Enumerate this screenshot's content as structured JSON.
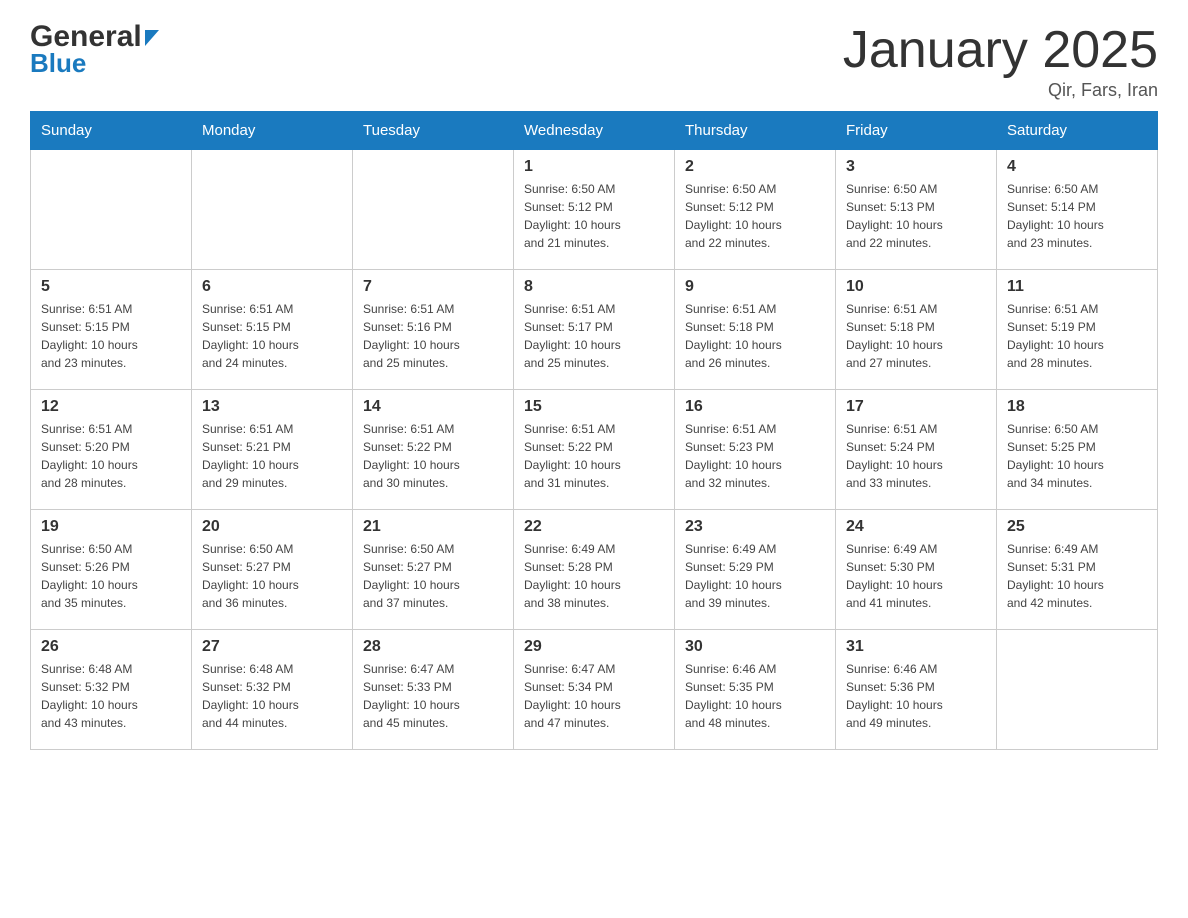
{
  "header": {
    "logo_text1": "General",
    "logo_text2": "Blue",
    "month_title": "January 2025",
    "subtitle": "Qir, Fars, Iran"
  },
  "days_of_week": [
    "Sunday",
    "Monday",
    "Tuesday",
    "Wednesday",
    "Thursday",
    "Friday",
    "Saturday"
  ],
  "weeks": [
    [
      {
        "day": "",
        "info": ""
      },
      {
        "day": "",
        "info": ""
      },
      {
        "day": "",
        "info": ""
      },
      {
        "day": "1",
        "info": "Sunrise: 6:50 AM\nSunset: 5:12 PM\nDaylight: 10 hours\nand 21 minutes."
      },
      {
        "day": "2",
        "info": "Sunrise: 6:50 AM\nSunset: 5:12 PM\nDaylight: 10 hours\nand 22 minutes."
      },
      {
        "day": "3",
        "info": "Sunrise: 6:50 AM\nSunset: 5:13 PM\nDaylight: 10 hours\nand 22 minutes."
      },
      {
        "day": "4",
        "info": "Sunrise: 6:50 AM\nSunset: 5:14 PM\nDaylight: 10 hours\nand 23 minutes."
      }
    ],
    [
      {
        "day": "5",
        "info": "Sunrise: 6:51 AM\nSunset: 5:15 PM\nDaylight: 10 hours\nand 23 minutes."
      },
      {
        "day": "6",
        "info": "Sunrise: 6:51 AM\nSunset: 5:15 PM\nDaylight: 10 hours\nand 24 minutes."
      },
      {
        "day": "7",
        "info": "Sunrise: 6:51 AM\nSunset: 5:16 PM\nDaylight: 10 hours\nand 25 minutes."
      },
      {
        "day": "8",
        "info": "Sunrise: 6:51 AM\nSunset: 5:17 PM\nDaylight: 10 hours\nand 25 minutes."
      },
      {
        "day": "9",
        "info": "Sunrise: 6:51 AM\nSunset: 5:18 PM\nDaylight: 10 hours\nand 26 minutes."
      },
      {
        "day": "10",
        "info": "Sunrise: 6:51 AM\nSunset: 5:18 PM\nDaylight: 10 hours\nand 27 minutes."
      },
      {
        "day": "11",
        "info": "Sunrise: 6:51 AM\nSunset: 5:19 PM\nDaylight: 10 hours\nand 28 minutes."
      }
    ],
    [
      {
        "day": "12",
        "info": "Sunrise: 6:51 AM\nSunset: 5:20 PM\nDaylight: 10 hours\nand 28 minutes."
      },
      {
        "day": "13",
        "info": "Sunrise: 6:51 AM\nSunset: 5:21 PM\nDaylight: 10 hours\nand 29 minutes."
      },
      {
        "day": "14",
        "info": "Sunrise: 6:51 AM\nSunset: 5:22 PM\nDaylight: 10 hours\nand 30 minutes."
      },
      {
        "day": "15",
        "info": "Sunrise: 6:51 AM\nSunset: 5:22 PM\nDaylight: 10 hours\nand 31 minutes."
      },
      {
        "day": "16",
        "info": "Sunrise: 6:51 AM\nSunset: 5:23 PM\nDaylight: 10 hours\nand 32 minutes."
      },
      {
        "day": "17",
        "info": "Sunrise: 6:51 AM\nSunset: 5:24 PM\nDaylight: 10 hours\nand 33 minutes."
      },
      {
        "day": "18",
        "info": "Sunrise: 6:50 AM\nSunset: 5:25 PM\nDaylight: 10 hours\nand 34 minutes."
      }
    ],
    [
      {
        "day": "19",
        "info": "Sunrise: 6:50 AM\nSunset: 5:26 PM\nDaylight: 10 hours\nand 35 minutes."
      },
      {
        "day": "20",
        "info": "Sunrise: 6:50 AM\nSunset: 5:27 PM\nDaylight: 10 hours\nand 36 minutes."
      },
      {
        "day": "21",
        "info": "Sunrise: 6:50 AM\nSunset: 5:27 PM\nDaylight: 10 hours\nand 37 minutes."
      },
      {
        "day": "22",
        "info": "Sunrise: 6:49 AM\nSunset: 5:28 PM\nDaylight: 10 hours\nand 38 minutes."
      },
      {
        "day": "23",
        "info": "Sunrise: 6:49 AM\nSunset: 5:29 PM\nDaylight: 10 hours\nand 39 minutes."
      },
      {
        "day": "24",
        "info": "Sunrise: 6:49 AM\nSunset: 5:30 PM\nDaylight: 10 hours\nand 41 minutes."
      },
      {
        "day": "25",
        "info": "Sunrise: 6:49 AM\nSunset: 5:31 PM\nDaylight: 10 hours\nand 42 minutes."
      }
    ],
    [
      {
        "day": "26",
        "info": "Sunrise: 6:48 AM\nSunset: 5:32 PM\nDaylight: 10 hours\nand 43 minutes."
      },
      {
        "day": "27",
        "info": "Sunrise: 6:48 AM\nSunset: 5:32 PM\nDaylight: 10 hours\nand 44 minutes."
      },
      {
        "day": "28",
        "info": "Sunrise: 6:47 AM\nSunset: 5:33 PM\nDaylight: 10 hours\nand 45 minutes."
      },
      {
        "day": "29",
        "info": "Sunrise: 6:47 AM\nSunset: 5:34 PM\nDaylight: 10 hours\nand 47 minutes."
      },
      {
        "day": "30",
        "info": "Sunrise: 6:46 AM\nSunset: 5:35 PM\nDaylight: 10 hours\nand 48 minutes."
      },
      {
        "day": "31",
        "info": "Sunrise: 6:46 AM\nSunset: 5:36 PM\nDaylight: 10 hours\nand 49 minutes."
      },
      {
        "day": "",
        "info": ""
      }
    ]
  ]
}
